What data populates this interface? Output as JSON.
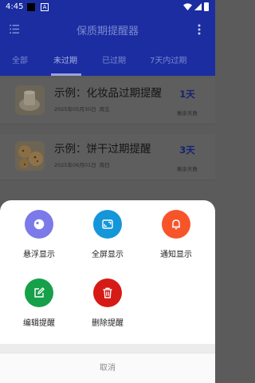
{
  "status_bar": {
    "time": "4:45",
    "notification_badge": "A"
  },
  "app_bar": {
    "title": "保质期提醒器"
  },
  "tabs": [
    {
      "label": "全部"
    },
    {
      "label": "未过期"
    },
    {
      "label": "已过期"
    },
    {
      "label": "7天内过期"
    }
  ],
  "reminders": [
    {
      "title": "示例：化妆品过期提醒",
      "date": "2025年05月30日",
      "weekday": "周五",
      "days": "1天",
      "days_label": "剩余天数",
      "thumb_icon": "cosmetics-image"
    },
    {
      "title": "示例：饼干过期提醒",
      "date": "2025年06月01日",
      "weekday": "周日",
      "days": "3天",
      "days_label": "剩余天数",
      "thumb_icon": "cookies-image"
    }
  ],
  "sheet": {
    "actions": [
      {
        "label": "悬浮显示",
        "icon": "floating-icon",
        "color": "#7b7ae8"
      },
      {
        "label": "全屏显示",
        "icon": "fullscreen-icon",
        "color": "#1596d9"
      },
      {
        "label": "通知显示",
        "icon": "bell-icon",
        "color": "#f7542a"
      },
      {
        "label": "编辑提醒",
        "icon": "edit-icon",
        "color": "#16a04a"
      },
      {
        "label": "删除提醒",
        "icon": "trash-icon",
        "color": "#d61b16"
      }
    ],
    "cancel_label": "取消"
  }
}
